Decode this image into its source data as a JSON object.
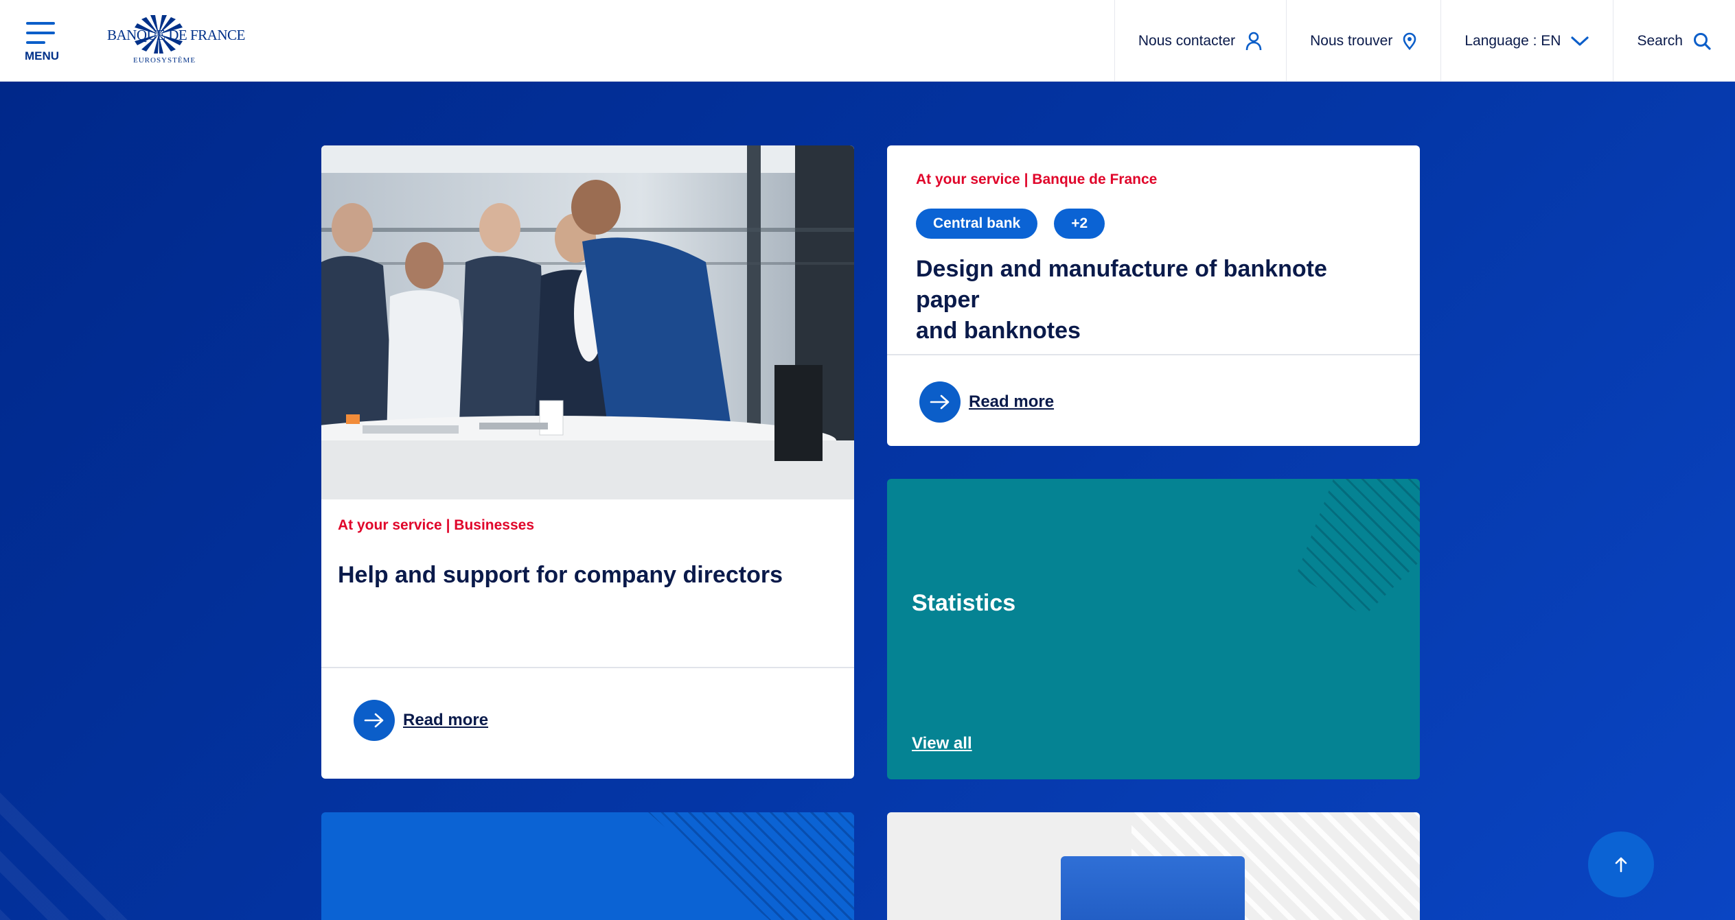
{
  "header": {
    "menu_label": "MENU",
    "logo": {
      "name": "BANQUE DE FRANCE",
      "subtitle": "EUROSYSTÈME"
    },
    "nav": {
      "contact": "Nous contacter",
      "find": "Nous trouver",
      "language": "Language : EN",
      "search": "Search"
    }
  },
  "cards": {
    "companies": {
      "eyebrow": "At your service | Businesses",
      "title": "Help and support for company directors",
      "read_more": "Read more"
    },
    "banknotes": {
      "eyebrow": "At your service | Banque de France",
      "tags": [
        "Central bank",
        "+2"
      ],
      "title_line1": "Design and manufacture of banknote paper",
      "title_line2": "and banknotes",
      "read_more": "Read more"
    },
    "statistics": {
      "title": "Statistics",
      "view_all": "View all"
    }
  },
  "colors": {
    "brand_blue": "#003189",
    "accent_blue": "#0b5ec9",
    "eyebrow_red": "#e0052a",
    "teal": "#058393"
  },
  "icons": {
    "menu": "hamburger-icon",
    "contact": "user-icon",
    "find": "map-pin-icon",
    "language": "chevron-down-icon",
    "search": "search-icon",
    "read_more": "arrow-right-icon",
    "back_to_top": "arrow-up-icon"
  }
}
